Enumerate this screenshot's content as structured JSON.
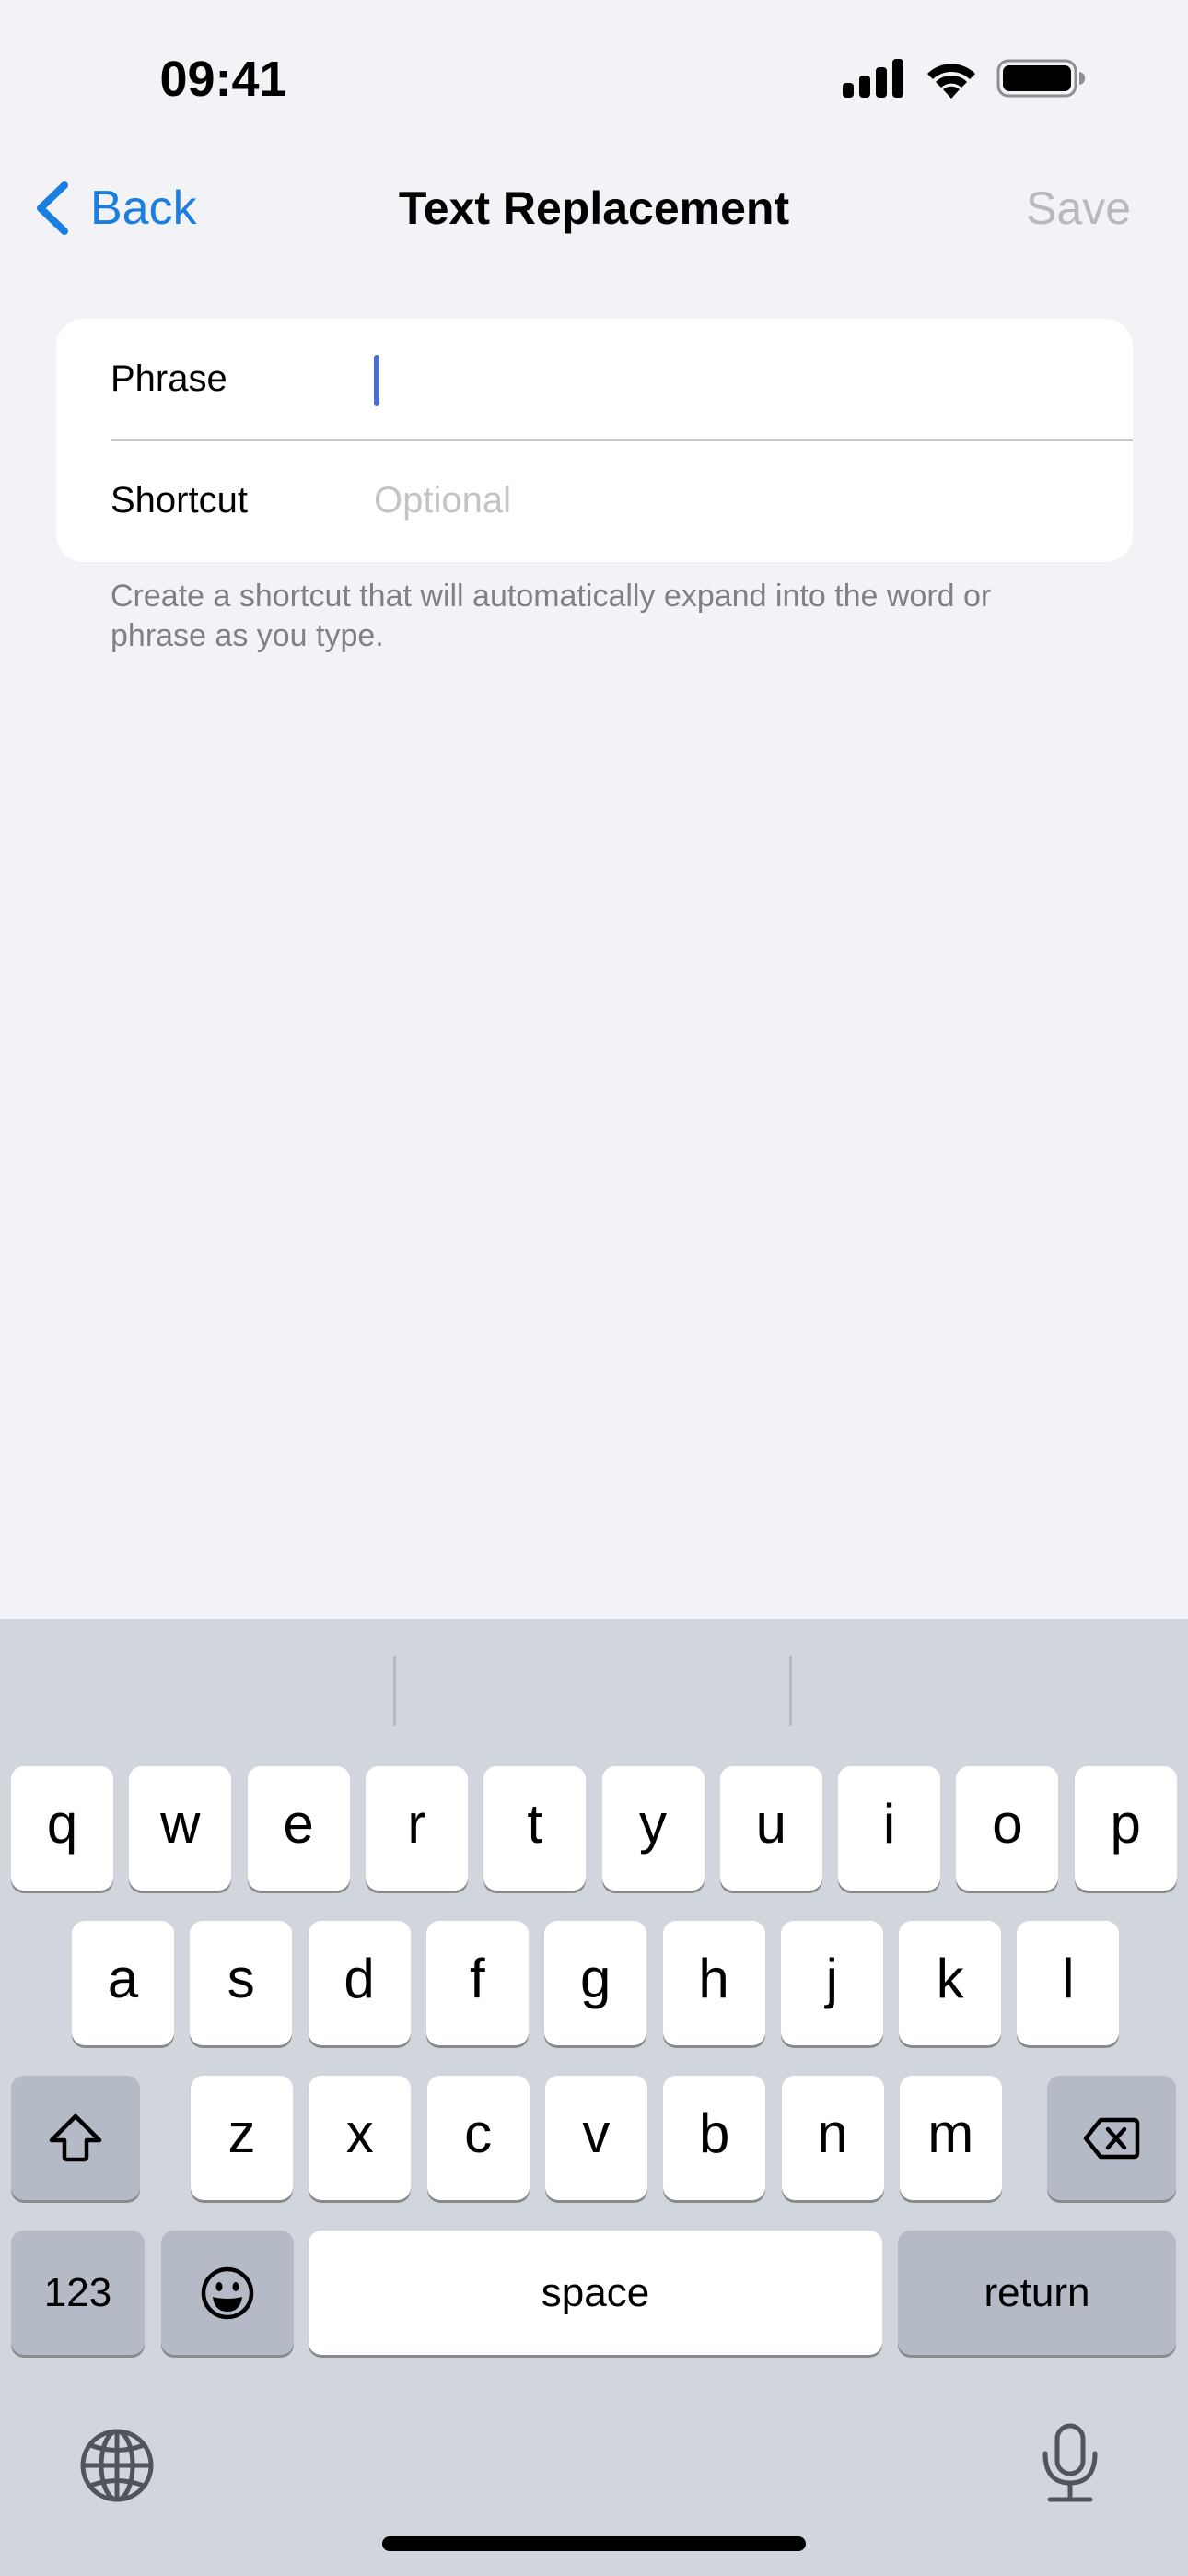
{
  "status_bar": {
    "time": "09:41",
    "icons": [
      "cellular-signal-icon",
      "wifi-icon",
      "battery-icon"
    ],
    "battery_level": 1.0
  },
  "nav": {
    "back_label": "Back",
    "title": "Text Replacement",
    "save_label": "Save",
    "save_enabled": false,
    "accent_color": "#1A7FE1",
    "disabled_color": "#B8B8BD"
  },
  "form": {
    "phrase": {
      "label": "Phrase",
      "value": "",
      "placeholder": "",
      "focused": true
    },
    "shortcut": {
      "label": "Shortcut",
      "value": "",
      "placeholder": "Optional"
    }
  },
  "footer": {
    "text": "Create a shortcut that will automatically expand into the word or phrase as you type."
  },
  "keyboard": {
    "row1": [
      "q",
      "w",
      "e",
      "r",
      "t",
      "y",
      "u",
      "i",
      "o",
      "p"
    ],
    "row2": [
      "a",
      "s",
      "d",
      "f",
      "g",
      "h",
      "j",
      "k",
      "l"
    ],
    "row3": [
      "z",
      "x",
      "c",
      "v",
      "b",
      "n",
      "m"
    ],
    "shift_icon": "shift-icon",
    "delete_icon": "delete-backward-icon",
    "numbers_label": "123",
    "emoji_icon": "emoji-icon",
    "space_label": "space",
    "return_label": "return",
    "globe_icon": "globe-icon",
    "mic_icon": "microphone-icon"
  }
}
